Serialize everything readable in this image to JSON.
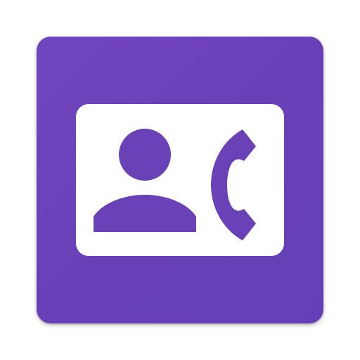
{
  "app_icon": {
    "icon_name": "contact-phone-icon",
    "colors": {
      "tile_background": "#6b41b8",
      "glyph_foreground": "#ffffff",
      "glyph_cutout": "#6b41b8"
    }
  }
}
